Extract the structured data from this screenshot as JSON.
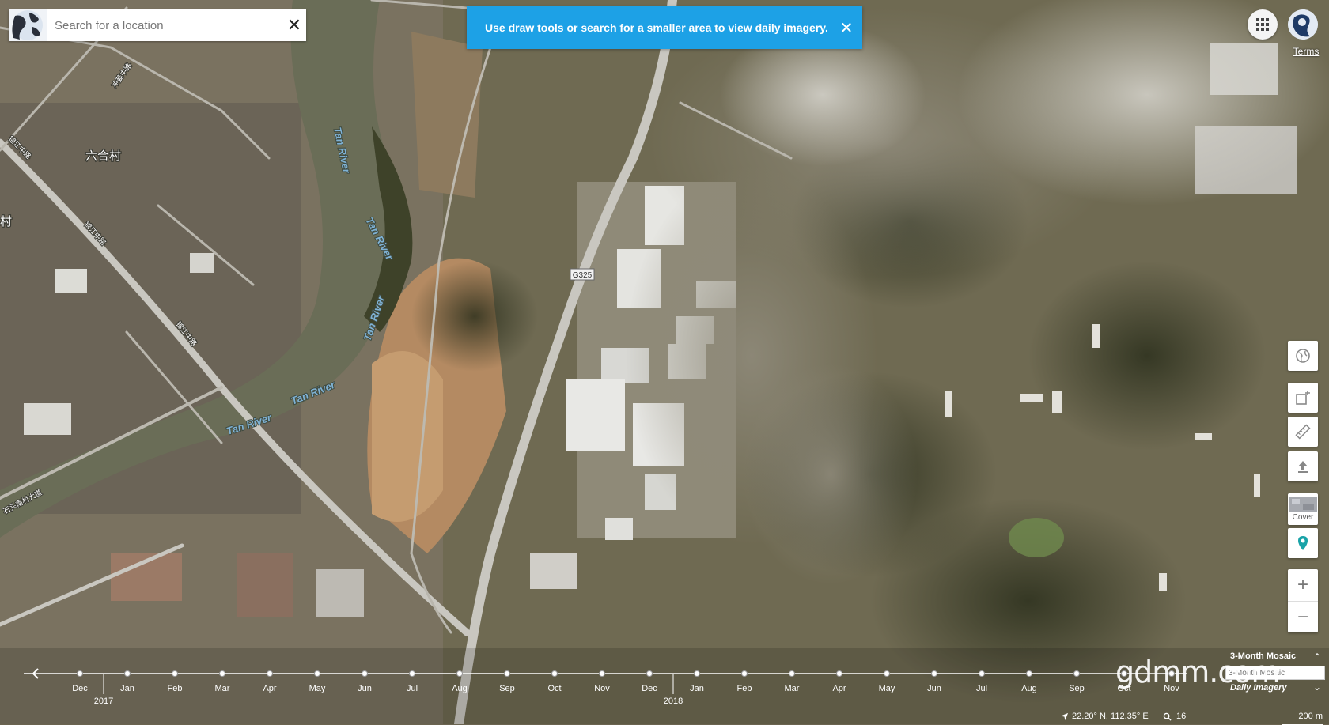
{
  "search": {
    "placeholder": "Search for a location"
  },
  "banner": {
    "message": "Use draw tools or search for a smaller area to view daily imagery."
  },
  "header": {
    "terms_label": "Terms"
  },
  "tools": {
    "cover_label": "Cover"
  },
  "map_labels": {
    "village": "六合村",
    "village_partial": "村",
    "river_labels": [
      "Tan River",
      "Tan River",
      "Tan River",
      "Tan River",
      "Tan River"
    ],
    "highway": "G325",
    "road_1": "锦江中路",
    "road_2": "锦江中路",
    "road_3": "锦江中路",
    "road_4": "石头南村大道",
    "road_5": "冲蒌中路"
  },
  "timeline": {
    "months": [
      "Dec",
      "Jan",
      "Feb",
      "Mar",
      "Apr",
      "May",
      "Jun",
      "Jul",
      "Aug",
      "Sep",
      "Oct",
      "Nov",
      "Dec",
      "Jan",
      "Feb",
      "Mar",
      "Apr",
      "May",
      "Jun",
      "Jul",
      "Aug",
      "Sep",
      "Oct",
      "Nov"
    ],
    "years": [
      {
        "label": "2017",
        "index": 0
      },
      {
        "label": "2018",
        "index": 12
      }
    ]
  },
  "basemap": {
    "title": "3-Month Mosaic",
    "subtitle": "Daily Imagery",
    "input_placeholder": "3-Month Mosaic"
  },
  "watermark": "gdmm.com",
  "status": {
    "coordinates": "22.20° N, 112.35° E",
    "zoom": "16",
    "scale": "200 m"
  }
}
